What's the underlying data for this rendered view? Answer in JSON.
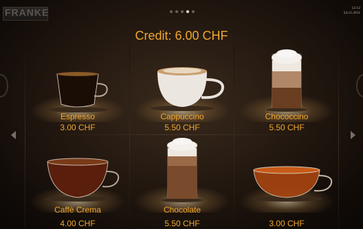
{
  "header": {
    "logo_text": "FRANKE",
    "page_dots": [
      false,
      false,
      false,
      true,
      false
    ],
    "time": "12:12",
    "date": "24.11.2011"
  },
  "credit_text": "Credit: 6.00 CHF",
  "products": [
    {
      "name": "Espresso",
      "price": "3.00 CHF",
      "icon": "espresso-cup-icon"
    },
    {
      "name": "Cappuccino",
      "price": "5.50 CHF",
      "icon": "cappuccino-cup-icon"
    },
    {
      "name": "Chococcino",
      "price": "5.50 CHF",
      "icon": "chococcino-glass-icon"
    },
    {
      "name": "Caffè Crema",
      "price": "4.00 CHF",
      "icon": "caffe-crema-cup-icon"
    },
    {
      "name": "Chocolate",
      "price": "5.50 CHF",
      "icon": "chocolate-glass-icon"
    },
    {
      "name": "",
      "price": "3.00 CHF",
      "icon": "tea-cup-icon"
    }
  ],
  "colors": {
    "accent": "#f0a830",
    "background": "#241911"
  }
}
